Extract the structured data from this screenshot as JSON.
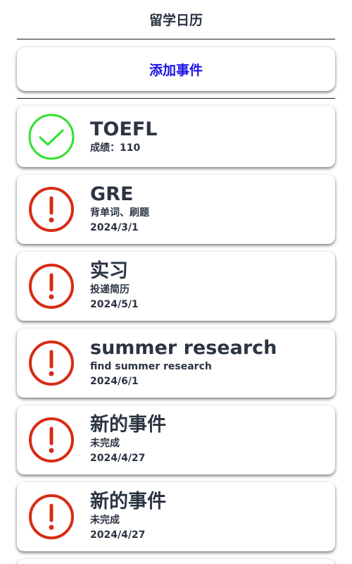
{
  "header": {
    "title": "留学日历"
  },
  "add_button": {
    "label": "添加事件"
  },
  "colors": {
    "done": "#2ee02e",
    "pending": "#d92b14",
    "accent": "#1a12e6"
  },
  "events": [
    {
      "title": "TOEFL",
      "subtitle": "成绩：110",
      "date": "",
      "status": "done",
      "icon": "check-circle-icon"
    },
    {
      "title": "GRE",
      "subtitle": "背单词、刷题",
      "date": "2024/3/1",
      "status": "pending",
      "icon": "exclamation-circle-icon"
    },
    {
      "title": "实习",
      "subtitle": "投递简历",
      "date": "2024/5/1",
      "status": "pending",
      "icon": "exclamation-circle-icon"
    },
    {
      "title": "summer research",
      "subtitle": "find summer research",
      "date": "2024/6/1",
      "status": "pending",
      "icon": "exclamation-circle-icon"
    },
    {
      "title": "新的事件",
      "subtitle": "未完成",
      "date": "2024/4/27",
      "status": "pending",
      "icon": "exclamation-circle-icon"
    },
    {
      "title": "新的事件",
      "subtitle": "未完成",
      "date": "2024/4/27",
      "status": "pending",
      "icon": "exclamation-circle-icon"
    }
  ]
}
